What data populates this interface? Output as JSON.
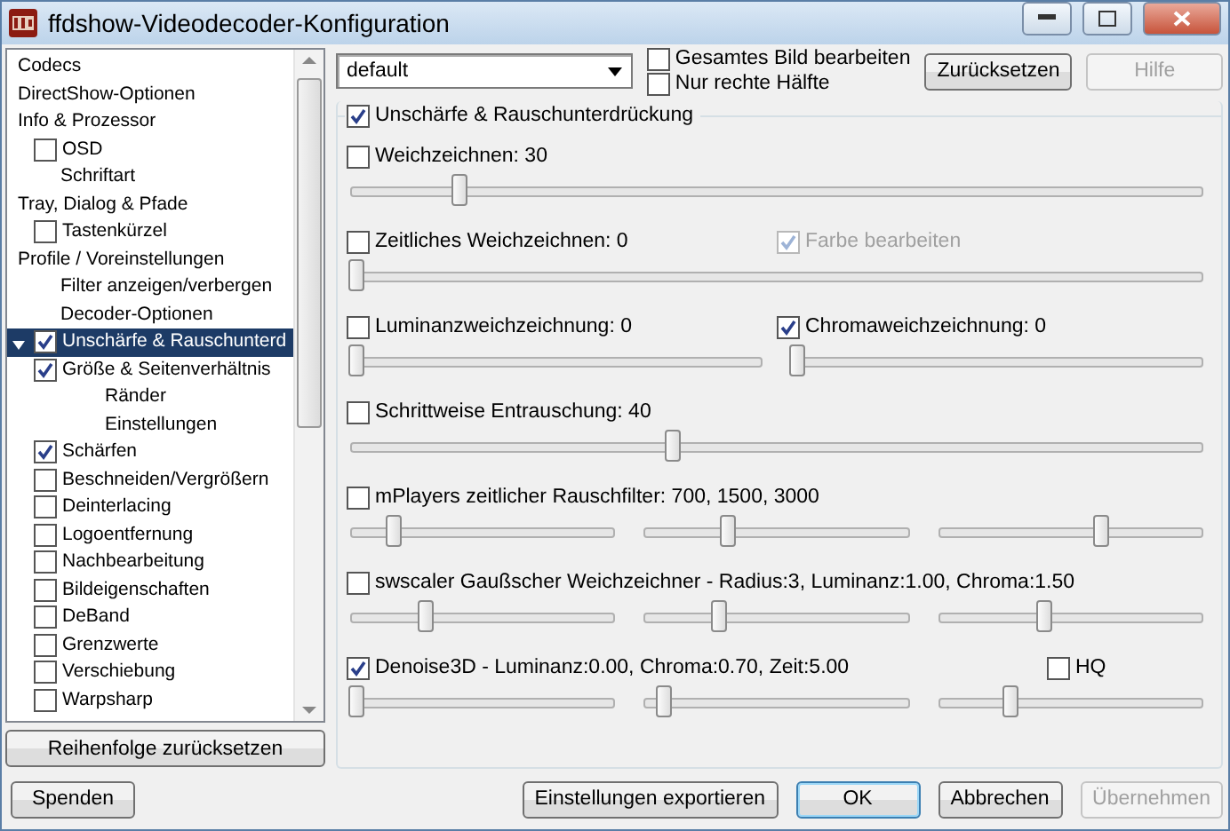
{
  "window": {
    "title": "ffdshow-Videodecoder-Konfiguration"
  },
  "tree": [
    {
      "label": "Codecs",
      "kind": "plain",
      "selected": false
    },
    {
      "label": "DirectShow-Optionen",
      "kind": "plain",
      "selected": false
    },
    {
      "label": "Info & Prozessor",
      "kind": "plain",
      "selected": false,
      "children": [
        {
          "label": "OSD",
          "kind": "check",
          "checked": false,
          "selected": false
        },
        {
          "label": "Schriftart",
          "kind": "plain",
          "selected": false
        }
      ]
    },
    {
      "label": "Tray, Dialog & Pfade",
      "kind": "plain",
      "selected": false,
      "children": [
        {
          "label": "Tastenkürzel",
          "kind": "check",
          "checked": false,
          "selected": false
        }
      ]
    },
    {
      "label": "Profile / Voreinstellungen",
      "kind": "plain",
      "selected": false,
      "children": [
        {
          "label": "Filter anzeigen/verbergen",
          "kind": "plain",
          "selected": false
        },
        {
          "label": "Decoder-Optionen",
          "kind": "plain",
          "selected": false
        },
        {
          "label": "Unschärfe & Rauschunterd",
          "kind": "check",
          "checked": true,
          "selected": true,
          "expanded": true
        },
        {
          "label": "Größe & Seitenverhältnis",
          "kind": "check",
          "checked": true,
          "selected": false,
          "children": [
            {
              "label": "Ränder",
              "kind": "plain",
              "selected": false
            },
            {
              "label": "Einstellungen",
              "kind": "plain",
              "selected": false
            }
          ]
        },
        {
          "label": "Schärfen",
          "kind": "check",
          "checked": true,
          "selected": false
        },
        {
          "label": "Beschneiden/Vergrößern",
          "kind": "check",
          "checked": false,
          "selected": false
        },
        {
          "label": "Deinterlacing",
          "kind": "check",
          "checked": false,
          "selected": false
        },
        {
          "label": "Logoentfernung",
          "kind": "check",
          "checked": false,
          "selected": false
        },
        {
          "label": "Nachbearbeitung",
          "kind": "check",
          "checked": false,
          "selected": false
        },
        {
          "label": "Bildeigenschaften",
          "kind": "check",
          "checked": false,
          "selected": false
        },
        {
          "label": "DeBand",
          "kind": "check",
          "checked": false,
          "selected": false
        },
        {
          "label": "Grenzwerte",
          "kind": "check",
          "checked": false,
          "selected": false
        },
        {
          "label": "Verschiebung",
          "kind": "check",
          "checked": false,
          "selected": false
        },
        {
          "label": "Warpsharp",
          "kind": "check",
          "checked": false,
          "selected": false
        }
      ]
    }
  ],
  "reset_order_button": "Reihenfolge zurücksetzen",
  "profile_select": {
    "value": "default"
  },
  "scope_options": [
    {
      "label": "Gesamtes Bild bearbeiten",
      "checked": false
    },
    {
      "label": "Nur rechte Hälfte",
      "checked": false
    }
  ],
  "top_buttons": [
    {
      "label": "Zurücksetzen",
      "disabled": false
    },
    {
      "label": "Hilfe",
      "disabled": true
    }
  ],
  "group": {
    "label": "Unschärfe & Rauschunterdrückung",
    "checked": true,
    "rows": [
      {
        "kind": "single",
        "checks": [
          {
            "label": "Weichzeichnen: 30",
            "checked": false,
            "disabled": false
          }
        ],
        "sliders": [
          {
            "level": 0.12
          }
        ]
      },
      {
        "kind": "split",
        "checks": [
          {
            "label": "Zeitliches Weichzeichnen: 0",
            "checked": false,
            "disabled": false
          },
          {
            "label": "Farbe bearbeiten",
            "checked": true,
            "disabled": true
          }
        ],
        "sliders": [
          {
            "level": 0
          }
        ]
      },
      {
        "kind": "split",
        "checks": [
          {
            "label": "Luminanzweichzeichnung: 0",
            "checked": false,
            "disabled": false
          },
          {
            "label": "Chromaweichzeichnung: 0",
            "checked": true,
            "disabled": false
          }
        ],
        "sliders": [
          {
            "level": 0
          },
          {
            "level": 0
          }
        ]
      },
      {
        "kind": "single",
        "checks": [
          {
            "label": "Schrittweise Entrauschung: 40",
            "checked": false,
            "disabled": false
          }
        ],
        "sliders": [
          {
            "level": 0.37
          }
        ]
      },
      {
        "kind": "single",
        "checks": [
          {
            "label": "mPlayers zeitlicher Rauschfilter: 700, 1500, 3000",
            "checked": false,
            "disabled": false
          }
        ],
        "sliders": [
          {
            "level": 0.14
          },
          {
            "level": 0.29
          },
          {
            "level": 0.59
          }
        ]
      },
      {
        "kind": "single",
        "checks": [
          {
            "label": "swscaler Gaußscher Weichzeichner - Radius:3, Luminanz:1.00, Chroma:1.50",
            "checked": false,
            "disabled": false
          }
        ],
        "sliders": [
          {
            "level": 0.26
          },
          {
            "level": 0.26
          },
          {
            "level": 0.38
          }
        ]
      },
      {
        "kind": "wide",
        "checks": [
          {
            "label": "Denoise3D - Luminanz:0.00, Chroma:0.70, Zeit:5.00",
            "checked": true,
            "disabled": false
          },
          {
            "label": "HQ",
            "checked": false,
            "disabled": false
          }
        ],
        "sliders": [
          {
            "level": 0
          },
          {
            "level": 0.05
          },
          {
            "level": 0.25
          }
        ]
      }
    ]
  },
  "bottom_left_button": "Spenden",
  "bottom_buttons": [
    {
      "label": "Einstellungen exportieren",
      "disabled": false,
      "default": false
    },
    {
      "label": "OK",
      "disabled": false,
      "default": true
    },
    {
      "label": "Abbrechen",
      "disabled": false,
      "default": false
    },
    {
      "label": "Übernehmen",
      "disabled": true,
      "default": false
    }
  ]
}
